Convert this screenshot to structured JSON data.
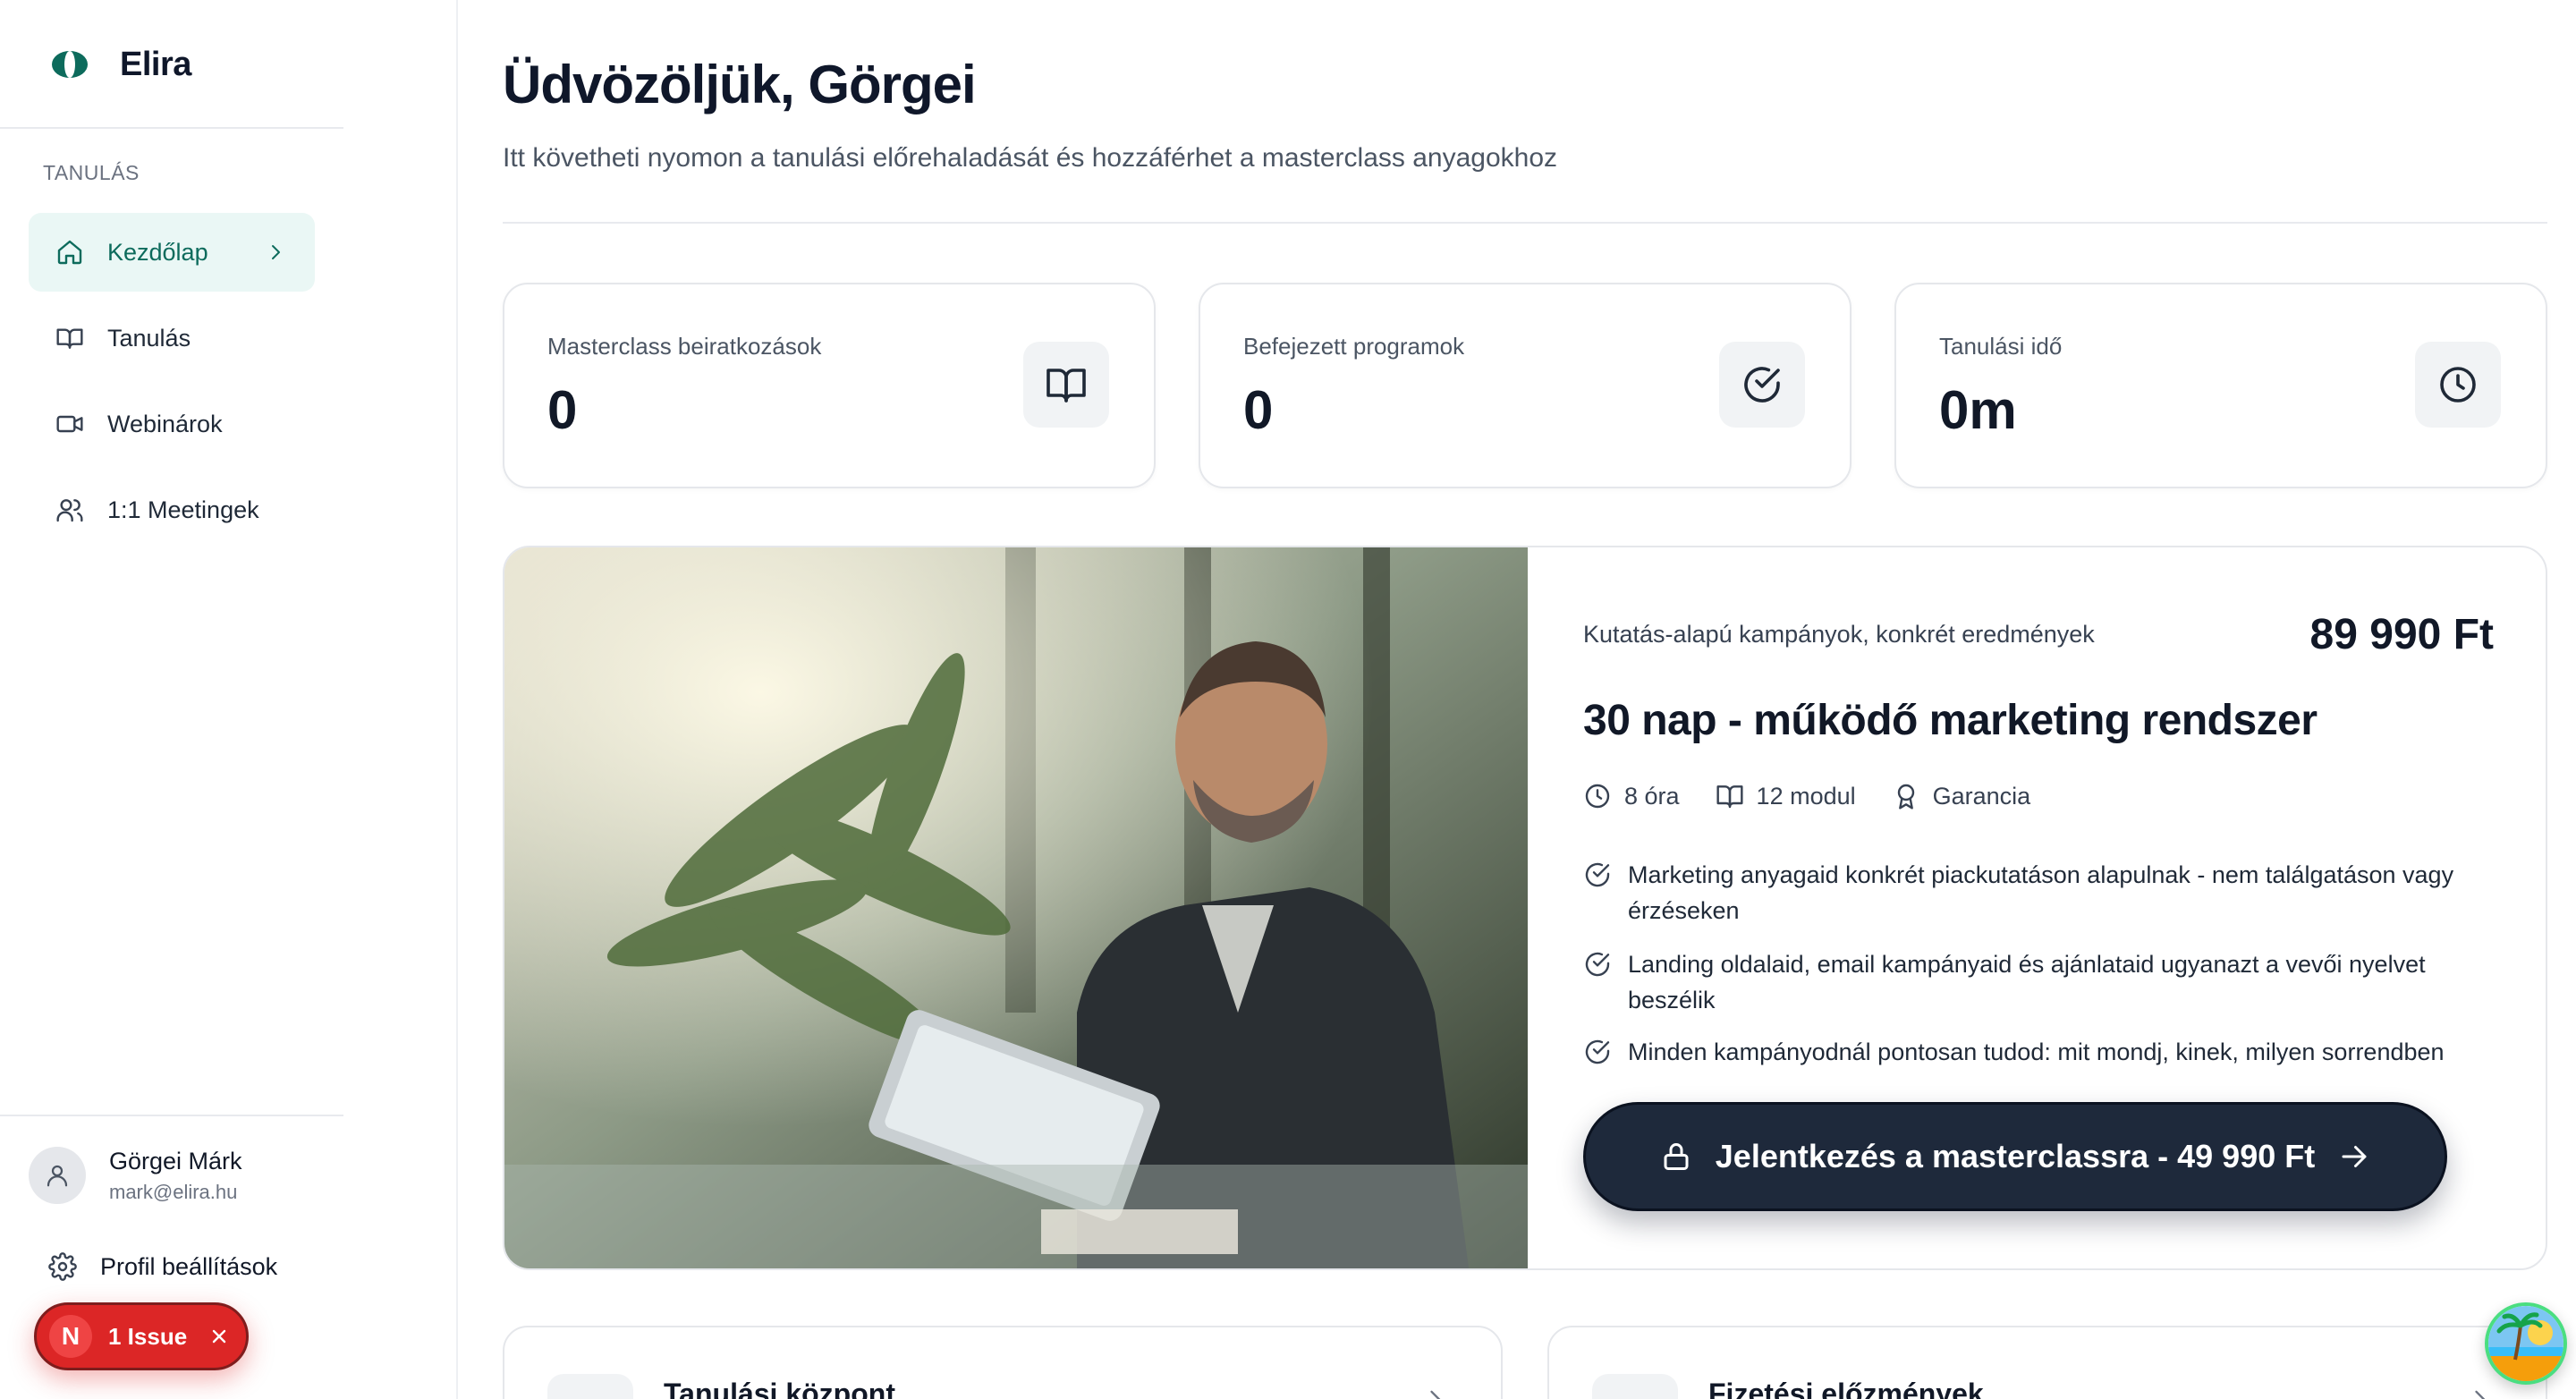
{
  "brand": {
    "name": "Elira",
    "accent": "#0d6b5c"
  },
  "sidebar": {
    "section_label": "TANULÁS",
    "items": [
      {
        "label": "Kezdőlap",
        "icon": "home-icon",
        "active": true
      },
      {
        "label": "Tanulás",
        "icon": "book-icon",
        "active": false
      },
      {
        "label": "Webinárok",
        "icon": "video-icon",
        "active": false
      },
      {
        "label": "1:1 Meetingek",
        "icon": "users-icon",
        "active": false
      }
    ],
    "user": {
      "name": "Görgei Márk",
      "email": "mark@elira.hu"
    },
    "settings_label": "Profil beállítások",
    "issue": {
      "badge": "N",
      "label": "1 Issue"
    }
  },
  "header": {
    "title": "Üdvözöljük, Görgei",
    "subtitle": "Itt követheti nyomon a tanulási előrehaladását és hozzáférhet a masterclass anyagokhoz"
  },
  "stats": [
    {
      "label": "Masterclass beiratkozások",
      "value": "0",
      "icon": "book-open-icon"
    },
    {
      "label": "Befejezett programok",
      "value": "0",
      "icon": "check-circle-icon"
    },
    {
      "label": "Tanulási idő",
      "value": "0m",
      "icon": "clock-icon"
    }
  ],
  "course": {
    "tagline": "Kutatás-alapú kampányok, konkrét eredmények",
    "price": "89 990 Ft",
    "title": "30 nap - működő marketing rendszer",
    "meta": [
      {
        "label": "8 óra",
        "icon": "clock-icon"
      },
      {
        "label": "12 modul",
        "icon": "book-icon"
      },
      {
        "label": "Garancia",
        "icon": "award-icon"
      }
    ],
    "features": [
      "Marketing anyagaid konkrét piackutatáson alapulnak - nem találgatáson vagy érzéseken",
      "Landing oldalaid, email kampányaid és ajánlataid ugyanazt a vevői nyelvet beszélik",
      "Minden kampányodnál pontosan tudod: mit mondj, kinek, milyen sorrendben"
    ],
    "cta_label": "Jelentkezés a masterclassra - 49 990 Ft"
  },
  "bottom_cards": [
    {
      "title": "Tanulási központ",
      "icon": "book-open-icon"
    },
    {
      "title": "Fizetési előzmények",
      "icon": "search-icon"
    }
  ]
}
